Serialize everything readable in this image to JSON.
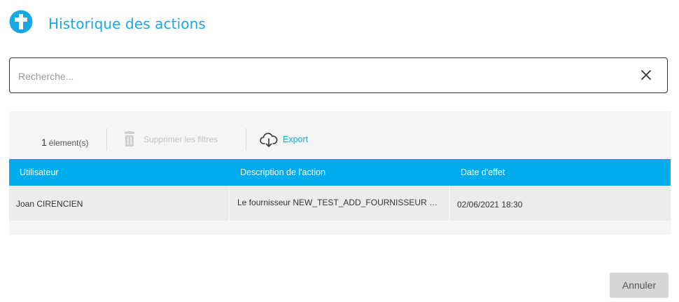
{
  "header": {
    "title": "Historique des actions"
  },
  "search": {
    "placeholder": "Recherche...",
    "value": ""
  },
  "toolbar": {
    "count_number": "1",
    "count_label": "élement(s)",
    "clear_filters_label": "Supprimer les filtres",
    "export_label": "Export"
  },
  "table": {
    "columns": [
      "Utilisateur",
      "Description de l'action",
      "Date d'effet"
    ],
    "rows": [
      [
        "Joan CIRENCIEN",
        "Le fournisseur NEW_TEST_ADD_FOURNISSEUR a ét...",
        "02/06/2021 18:30"
      ]
    ]
  },
  "footer": {
    "cancel_label": "Annuler"
  },
  "colors": {
    "accent": "#17a8e3",
    "header_bg": "#00acec"
  }
}
